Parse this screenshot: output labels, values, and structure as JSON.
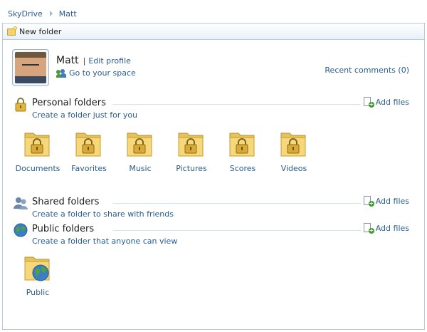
{
  "breadcrumb": {
    "root": "SkyDrive",
    "current": "Matt"
  },
  "toolbar": {
    "new_folder_label": "New folder"
  },
  "profile": {
    "name": "Matt",
    "edit_profile": "Edit profile",
    "go_to_space": "Go to your space"
  },
  "recent_comments": "Recent comments (0)",
  "add_files_label": "Add files",
  "sections": {
    "personal": {
      "title": "Personal folders",
      "subtitle": "Create a folder just for you"
    },
    "shared": {
      "title": "Shared folders",
      "subtitle": "Create a folder to share with friends"
    },
    "public": {
      "title": "Public folders",
      "subtitle": "Create a folder that anyone can view"
    }
  },
  "personal_folders": [
    "Documents",
    "Favorites",
    "Music",
    "Pictures",
    "Scores",
    "Videos"
  ],
  "public_folders": [
    "Public"
  ],
  "colors": {
    "link": "#2a5d91",
    "folder": "#f3d36a",
    "border": "#b7cbdc"
  }
}
